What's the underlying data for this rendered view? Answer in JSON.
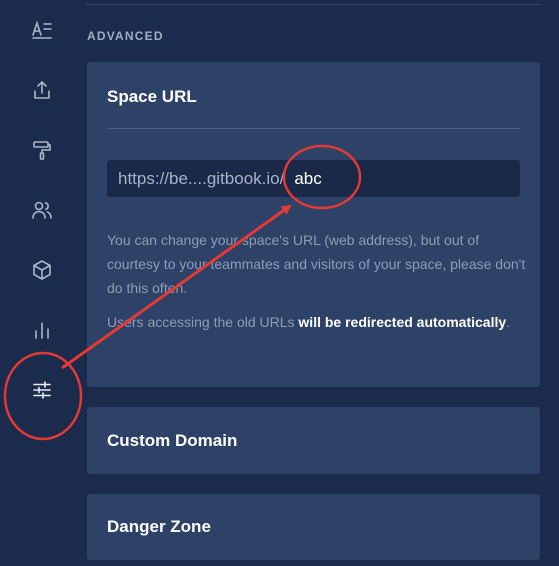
{
  "sidebar": {
    "icons": [
      {
        "name": "content-icon"
      },
      {
        "name": "share-icon"
      },
      {
        "name": "customize-icon"
      },
      {
        "name": "members-icon"
      },
      {
        "name": "integrations-icon"
      },
      {
        "name": "insights-icon"
      },
      {
        "name": "settings-icon"
      }
    ]
  },
  "main": {
    "section_label": "ADVANCED",
    "space_url": {
      "title": "Space URL",
      "url_prefix": "https://be....gitbook.io/",
      "url_slug": "abc",
      "help_line1": "You can change your space's URL (web address), but out of courtesy to your teammates and visitors of your space, please don't do this often.",
      "help_line2_before": "Users accessing the old URLs ",
      "help_line2_bold": "will be redirected automatically",
      "help_line2_after": "."
    },
    "custom_domain": {
      "title": "Custom Domain"
    },
    "danger_zone": {
      "title": "Danger Zone"
    }
  },
  "colors": {
    "background": "#1b2b4c",
    "panel": "#2d4266",
    "input": "#1a2947",
    "annotation": "#e53935"
  }
}
